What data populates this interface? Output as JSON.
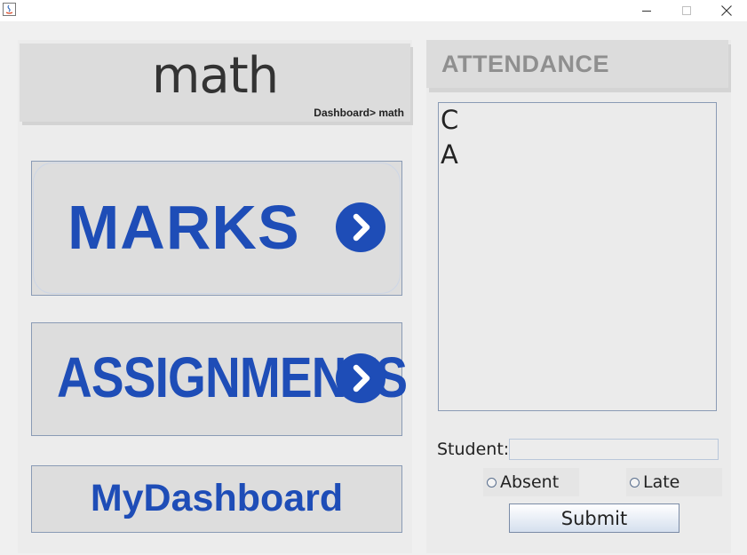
{
  "window": {
    "title": ""
  },
  "header": {
    "title": "math",
    "breadcrumb": "Dashboard> math"
  },
  "buttons": {
    "marks": "MARKS",
    "assignments": "ASSIGNMENTS",
    "dashboard": "MyDashboard"
  },
  "attendance": {
    "title": "ATTENDANCE",
    "students": [
      "C",
      "A"
    ],
    "student_label": "Student:",
    "student_value": "",
    "absent_label": "Absent",
    "late_label": "Late",
    "submit_label": "Submit"
  },
  "colors": {
    "accent": "#1e4db7",
    "attendance_title": "#8f8f8f"
  }
}
